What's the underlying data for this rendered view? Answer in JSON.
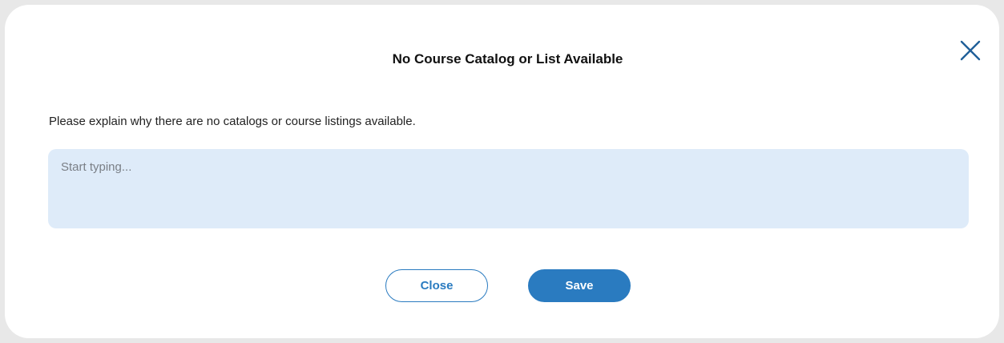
{
  "dialog": {
    "title": "No Course Catalog or List Available",
    "prompt": "Please explain why there are no catalogs or course listings available.",
    "input": {
      "value": "",
      "placeholder": "Start typing..."
    },
    "buttons": {
      "close_label": "Close",
      "save_label": "Save"
    },
    "icons": {
      "close": "close-icon"
    }
  },
  "colors": {
    "accent": "#2a7bc0",
    "input_background": "#deebf9",
    "dialog_background": "#ffffff",
    "page_background": "#e8e8e8"
  }
}
